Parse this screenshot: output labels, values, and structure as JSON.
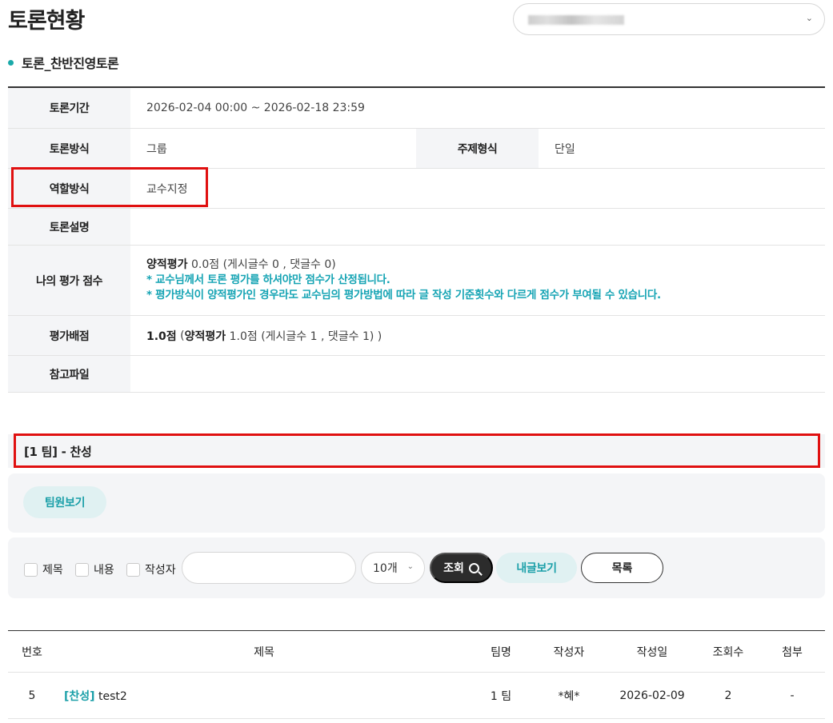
{
  "page": {
    "title": "토론현황"
  },
  "course_select": {
    "value_blurred": true,
    "chevron": "chevron-down-icon"
  },
  "discussion": {
    "name": "토론_찬반진영토론"
  },
  "info": {
    "period_label": "토론기간",
    "period_value": "2026-02-04 00:00 ~ 2026-02-18 23:59",
    "method_label": "토론방식",
    "method_value": "그룹",
    "topic_type_label": "주제형식",
    "topic_type_value": "단일",
    "role_label": "역할방식",
    "role_value": "교수지정",
    "desc_label": "토론설명",
    "desc_value": "",
    "my_score_label": "나의 평가 점수",
    "my_score_type": "양적평가",
    "my_score_value": "0.0점 (게시글수 0 , 댓글수 0)",
    "my_score_note1": "* 교수님께서 토론 평가를 하셔야만 점수가 산정됩니다.",
    "my_score_note2": "* 평가방식이 양적평가인 경우라도 교수님의 평가방법에 따라 글 작성 기준횟수와 다르게 점수가 부여될 수 있습니다.",
    "allot_label": "평가배점",
    "allot_total": "1.0점",
    "allot_open": "(",
    "allot_type": "양적평가",
    "allot_detail": "1.0점 (게시글수 1 , 댓글수 1) )",
    "file_label": "참고파일",
    "file_value": ""
  },
  "team": {
    "heading": "[1 팀] - 찬성",
    "members_button": "팀원보기"
  },
  "search": {
    "opt_title": "제목",
    "opt_content": "내용",
    "opt_writer": "작성자",
    "keyword": "",
    "page_size": "10개",
    "search_button": "조회",
    "my_posts_button": "내글보기",
    "list_button": "목록"
  },
  "list": {
    "headers": {
      "num": "번호",
      "title": "제목",
      "team": "팀명",
      "writer": "작성자",
      "date": "작성일",
      "views": "조회수",
      "attach": "첨부"
    },
    "rows": [
      {
        "num": "5",
        "tag": "[찬성]",
        "title": "test2",
        "team": "1 팀",
        "writer": "*혜*",
        "date": "2026-02-09",
        "views": "2",
        "attach": "-"
      }
    ]
  },
  "colors": {
    "accent": "#1aa9a9",
    "highlight": "#e01010",
    "dark_button": "#2c2c2c"
  }
}
